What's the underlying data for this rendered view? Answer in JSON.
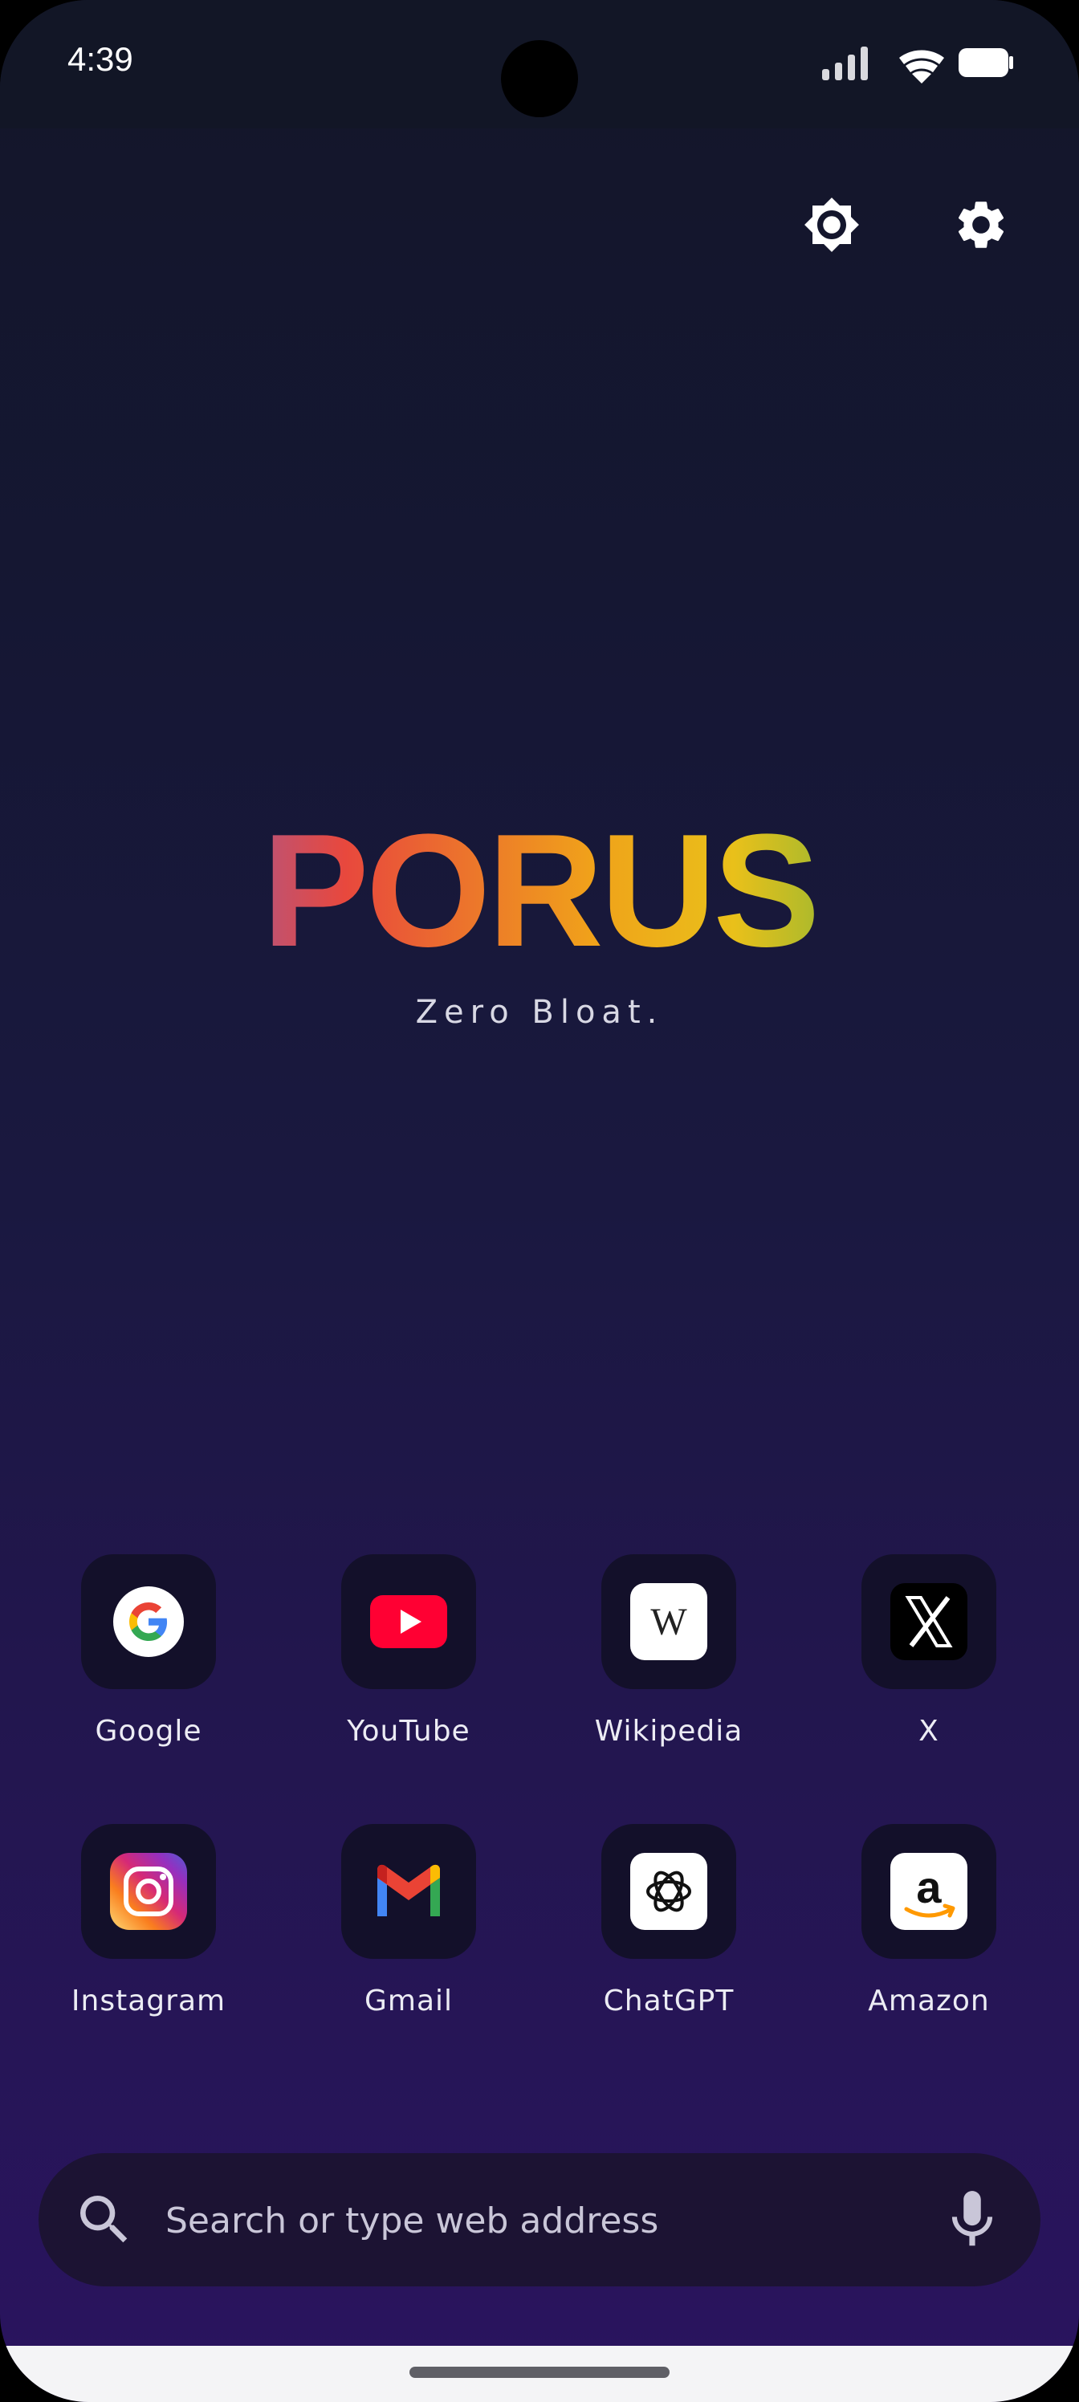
{
  "status_bar": {
    "time": "4:39"
  },
  "header": {
    "brightness_icon": "brightness-icon",
    "settings_icon": "gear-icon"
  },
  "hero": {
    "logo": "PORUS",
    "tagline": "Zero Bloat."
  },
  "shortcuts": [
    {
      "label": "Google",
      "icon": "google-icon"
    },
    {
      "label": "YouTube",
      "icon": "youtube-icon"
    },
    {
      "label": "Wikipedia",
      "icon": "wikipedia-icon"
    },
    {
      "label": "X",
      "icon": "x-icon"
    },
    {
      "label": "Instagram",
      "icon": "instagram-icon"
    },
    {
      "label": "Gmail",
      "icon": "gmail-icon"
    },
    {
      "label": "ChatGPT",
      "icon": "chatgpt-icon"
    },
    {
      "label": "Amazon",
      "icon": "amazon-icon"
    }
  ],
  "search": {
    "placeholder": "Search or type web address",
    "value": ""
  },
  "colors": {
    "background_top": "#131629",
    "background_bottom": "#2a145f",
    "tile_background": "#13102a",
    "search_background": "#1c1333"
  }
}
